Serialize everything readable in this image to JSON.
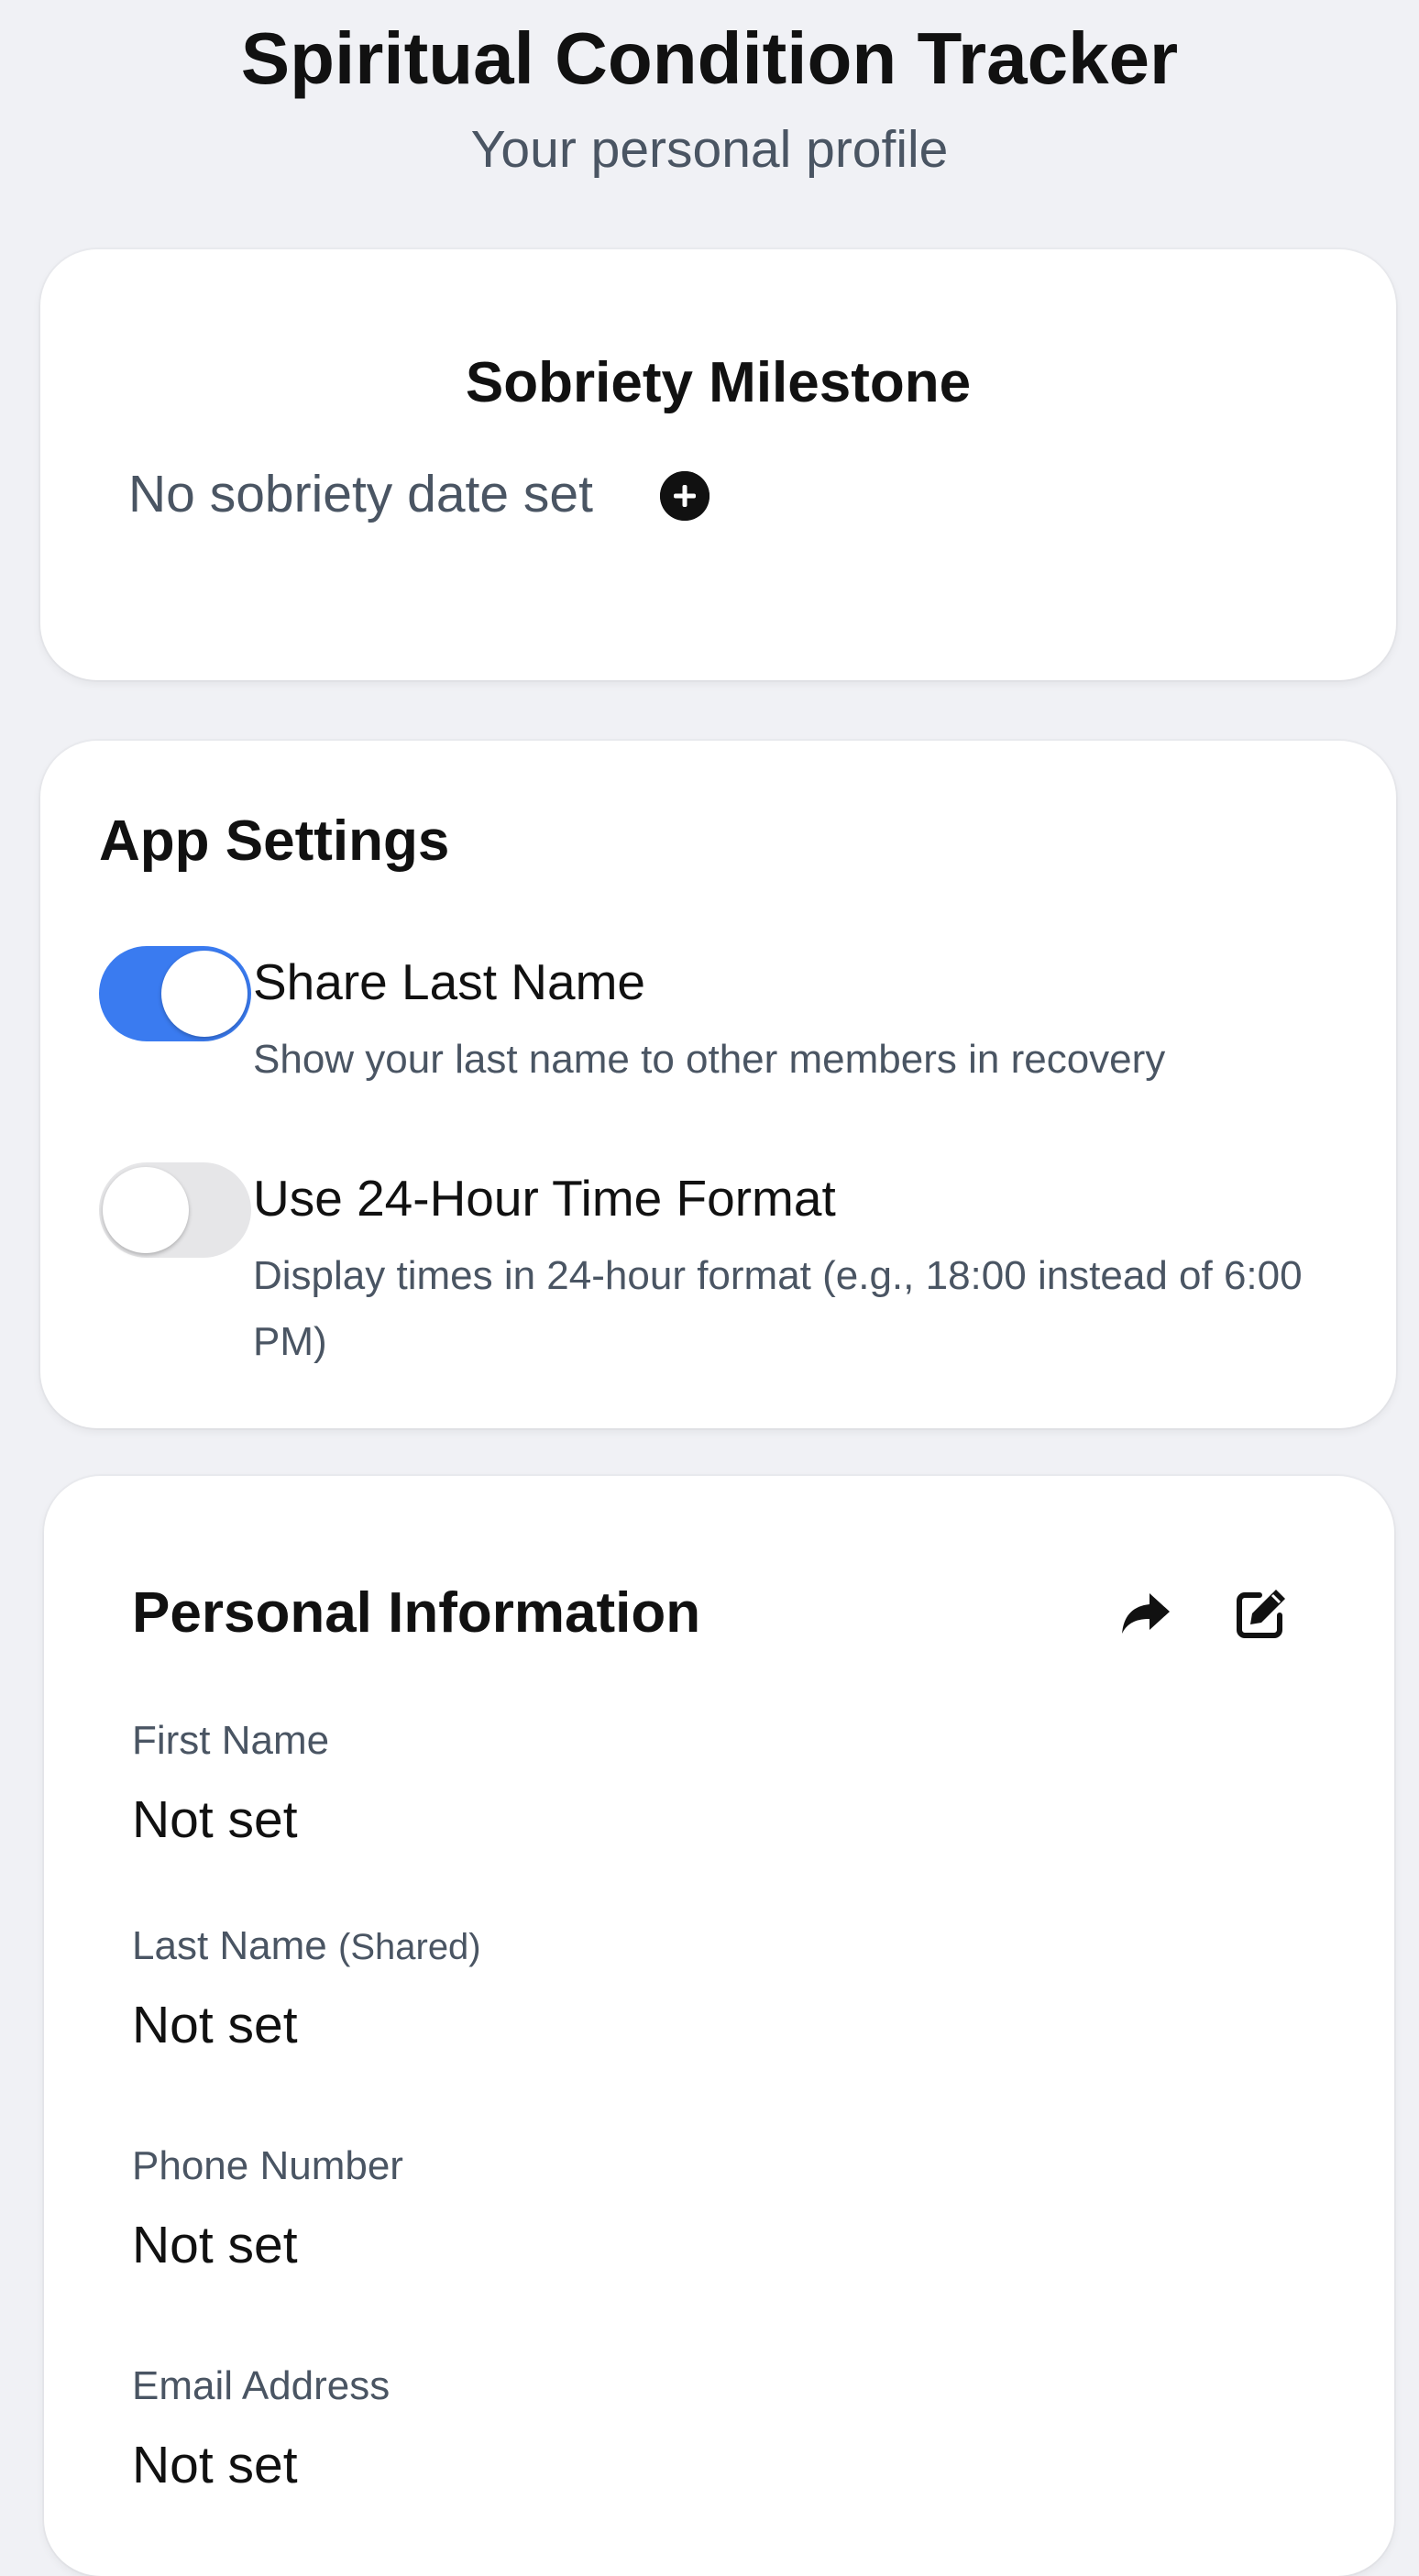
{
  "header": {
    "title": "Spiritual Condition Tracker",
    "subtitle": "Your personal profile"
  },
  "sobriety": {
    "title": "Sobriety Milestone",
    "status_text": "No sobriety date set",
    "add_icon": "plus-circle-icon"
  },
  "settings": {
    "title": "App Settings",
    "items": [
      {
        "label": "Share Last Name",
        "description": "Show your last name to other members in recovery",
        "enabled": true
      },
      {
        "label": "Use 24-Hour Time Format",
        "description": "Display times in 24-hour format (e.g., 18:00 instead of 6:00 PM)",
        "enabled": false
      }
    ]
  },
  "personal": {
    "title": "Personal Information",
    "share_icon": "share-icon",
    "edit_icon": "edit-icon",
    "fields": [
      {
        "label": "First Name",
        "suffix": "",
        "value": "Not set"
      },
      {
        "label": "Last Name",
        "suffix": "(Shared)",
        "value": "Not set"
      },
      {
        "label": "Phone Number",
        "suffix": "",
        "value": "Not set"
      },
      {
        "label": "Email Address",
        "suffix": "",
        "value": "Not set"
      }
    ]
  },
  "colors": {
    "background": "#f0f1f5",
    "card": "#ffffff",
    "accent": "#3a7bf0",
    "text_primary": "#111111",
    "text_secondary": "#4a5563",
    "toggle_off": "#e6e6e8"
  }
}
